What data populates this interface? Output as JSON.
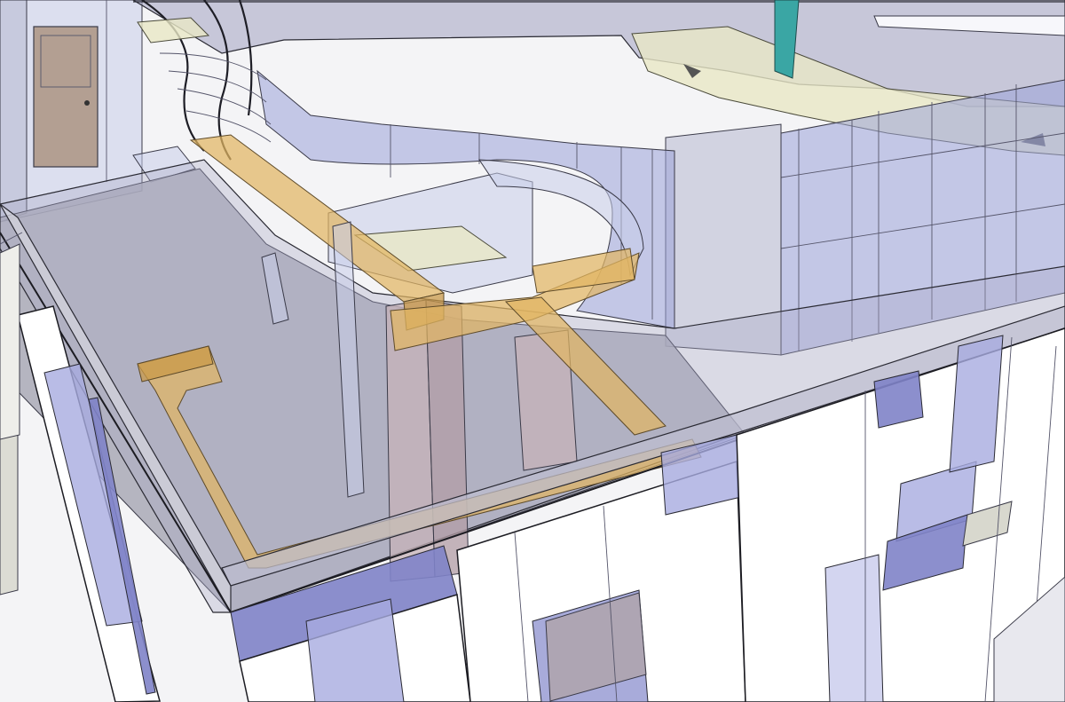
{
  "viewport": {
    "description_visible_text": ""
  },
  "colors": {
    "background": "#f4f4f6",
    "glass": "#9aa3d8",
    "slab": "#a8a9c6",
    "beam": "#e2b562",
    "facade_white": "#ffffff",
    "facade_purple": "#7f83c8",
    "column_pink": "#c7b3b8",
    "teal_marker": "#3aa6a4",
    "door": "#b39f92"
  },
  "icons": {
    "camera_arrow": "arrow-icon"
  }
}
